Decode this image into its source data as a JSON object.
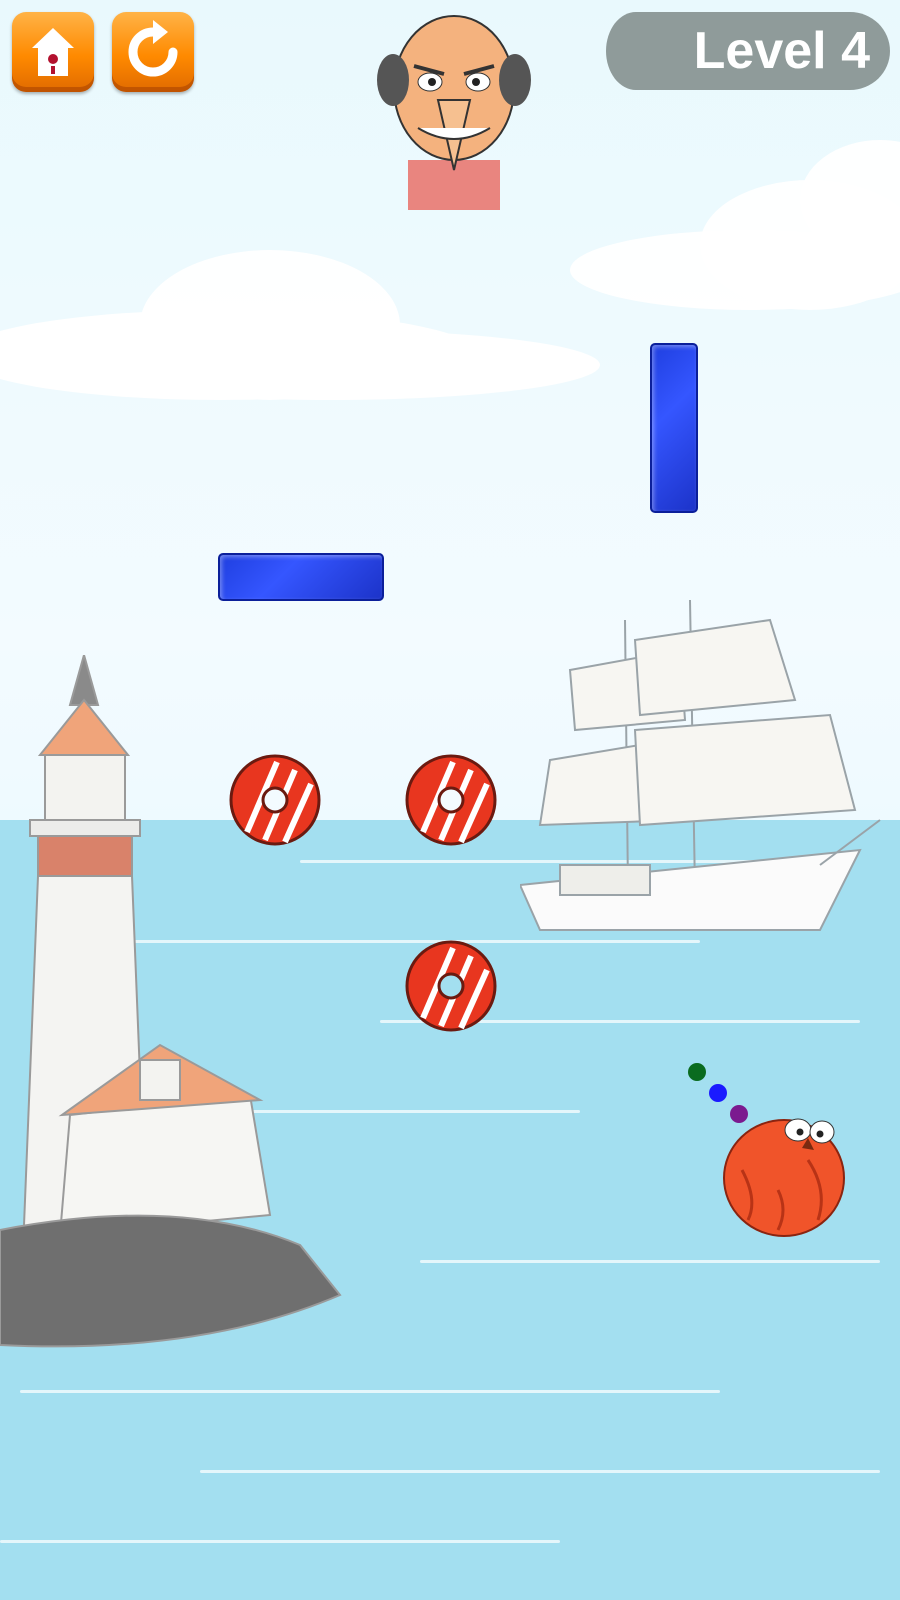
{
  "header": {
    "level_label": "Level 4"
  },
  "buttons": {
    "home_icon": "birdhouse-home-icon",
    "restart_icon": "restart-arrow-icon"
  },
  "colors": {
    "button_orange": "#ff8a00",
    "bar_blue": "#2343e6",
    "donut_red": "#e8361f",
    "pill_gray": "#8f9b9a",
    "trajectory": [
      "#0a6b1f",
      "#1a1aff",
      "#7b1a8f"
    ]
  },
  "game": {
    "donut_count": 3,
    "blue_bar_count": 2,
    "trajectory_dots": 3
  }
}
